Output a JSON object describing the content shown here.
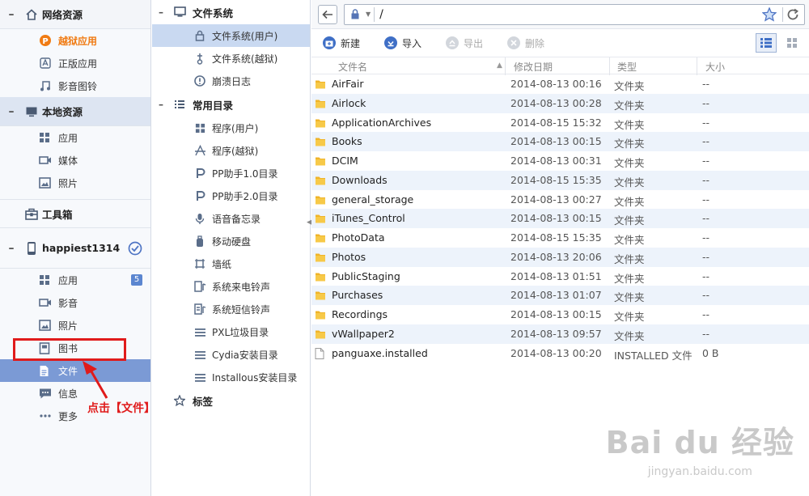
{
  "sidebar": {
    "sections": [
      {
        "label": "网络资源",
        "icon": "home-icon",
        "items": [
          {
            "label": "越狱应用",
            "icon": "pp-logo-icon",
            "highlight": true
          },
          {
            "label": "正版应用",
            "icon": "app-store-icon"
          },
          {
            "label": "影音图铃",
            "icon": "music-note-icon"
          }
        ]
      },
      {
        "label": "本地资源",
        "icon": "monitor-icon",
        "active": true,
        "items": [
          {
            "label": "应用",
            "icon": "apps-grid-icon"
          },
          {
            "label": "媒体",
            "icon": "video-camera-icon"
          },
          {
            "label": "照片",
            "icon": "photo-icon"
          }
        ]
      },
      {
        "label": "工具箱",
        "icon": "toolbox-icon",
        "items": []
      },
      {
        "label": "happiest1314",
        "icon": "phone-icon",
        "items": [
          {
            "label": "应用",
            "icon": "apps-grid-icon",
            "badge": "5"
          },
          {
            "label": "影音",
            "icon": "video-camera-icon"
          },
          {
            "label": "照片",
            "icon": "photo-icon"
          },
          {
            "label": "图书",
            "icon": "book-icon"
          },
          {
            "label": "文件",
            "icon": "document-icon",
            "selected": true
          },
          {
            "label": "信息",
            "icon": "chat-icon"
          },
          {
            "label": "更多",
            "icon": "more-dots-icon"
          }
        ]
      }
    ]
  },
  "annotation": {
    "text": "点击【文件】",
    "color": "#e01b1b"
  },
  "tree": {
    "filesystem": {
      "label": "文件系统",
      "items": [
        {
          "label": "文件系统(用户)",
          "icon": "lock-icon",
          "selected": true
        },
        {
          "label": "文件系统(越狱)",
          "icon": "jailbreak-icon"
        },
        {
          "label": "崩溃日志",
          "icon": "alert-icon"
        }
      ]
    },
    "common": {
      "label": "常用目录",
      "items": [
        {
          "label": "程序(用户)",
          "icon": "apps-grid-icon"
        },
        {
          "label": "程序(越狱)",
          "icon": "cydia-a-icon"
        },
        {
          "label": "PP助手1.0目录",
          "icon": "pp-logo-icon"
        },
        {
          "label": "PP助手2.0目录",
          "icon": "pp-logo-icon"
        },
        {
          "label": "语音备忘录",
          "icon": "microphone-icon"
        },
        {
          "label": "移动硬盘",
          "icon": "usb-drive-icon"
        },
        {
          "label": "墙纸",
          "icon": "wallpaper-icon"
        },
        {
          "label": "系统来电铃声",
          "icon": "ringtone-icon"
        },
        {
          "label": "系统短信铃声",
          "icon": "sms-ringtone-icon"
        },
        {
          "label": "PXL垃圾目录",
          "icon": "list-icon"
        },
        {
          "label": "Cydia安装目录",
          "icon": "list-icon"
        },
        {
          "label": "Installous安装目录",
          "icon": "list-icon"
        }
      ]
    },
    "bookmarks": {
      "label": "标签"
    }
  },
  "address": {
    "path": "/"
  },
  "toolbar": {
    "new_label": "新建",
    "import_label": "导入",
    "export_label": "导出",
    "delete_label": "删除"
  },
  "columns": {
    "name": "文件名",
    "date": "修改日期",
    "type": "类型",
    "size": "大小"
  },
  "files": [
    {
      "name": "AirFair",
      "date": "2014-08-13 00:16",
      "type": "文件夹",
      "size": "--",
      "kind": "folder"
    },
    {
      "name": "Airlock",
      "date": "2014-08-13 00:28",
      "type": "文件夹",
      "size": "--",
      "kind": "folder"
    },
    {
      "name": "ApplicationArchives",
      "date": "2014-08-15 15:32",
      "type": "文件夹",
      "size": "--",
      "kind": "folder"
    },
    {
      "name": "Books",
      "date": "2014-08-13 00:15",
      "type": "文件夹",
      "size": "--",
      "kind": "folder"
    },
    {
      "name": "DCIM",
      "date": "2014-08-13 00:31",
      "type": "文件夹",
      "size": "--",
      "kind": "folder"
    },
    {
      "name": "Downloads",
      "date": "2014-08-15 15:35",
      "type": "文件夹",
      "size": "--",
      "kind": "folder"
    },
    {
      "name": "general_storage",
      "date": "2014-08-13 00:27",
      "type": "文件夹",
      "size": "--",
      "kind": "folder"
    },
    {
      "name": "iTunes_Control",
      "date": "2014-08-13 00:15",
      "type": "文件夹",
      "size": "--",
      "kind": "folder"
    },
    {
      "name": "PhotoData",
      "date": "2014-08-15 15:35",
      "type": "文件夹",
      "size": "--",
      "kind": "folder"
    },
    {
      "name": "Photos",
      "date": "2014-08-13 20:06",
      "type": "文件夹",
      "size": "--",
      "kind": "folder"
    },
    {
      "name": "PublicStaging",
      "date": "2014-08-13 01:51",
      "type": "文件夹",
      "size": "--",
      "kind": "folder"
    },
    {
      "name": "Purchases",
      "date": "2014-08-13 01:07",
      "type": "文件夹",
      "size": "--",
      "kind": "folder"
    },
    {
      "name": "Recordings",
      "date": "2014-08-13 00:15",
      "type": "文件夹",
      "size": "--",
      "kind": "folder"
    },
    {
      "name": "vWallpaper2",
      "date": "2014-08-13 09:57",
      "type": "文件夹",
      "size": "--",
      "kind": "folder"
    },
    {
      "name": "panguaxe.installed",
      "date": "2014-08-13 00:20",
      "type": "INSTALLED 文件",
      "size": "0 B",
      "kind": "file"
    }
  ],
  "watermark": {
    "brand": "Bai du 经验",
    "url": "jingyan.baidu.com"
  },
  "colors": {
    "accent": "#5b86d0",
    "selected_row": "#7b9ad5",
    "highlight": "#f07b13",
    "folder": "#f0b429",
    "annotation": "#e01b1b"
  }
}
